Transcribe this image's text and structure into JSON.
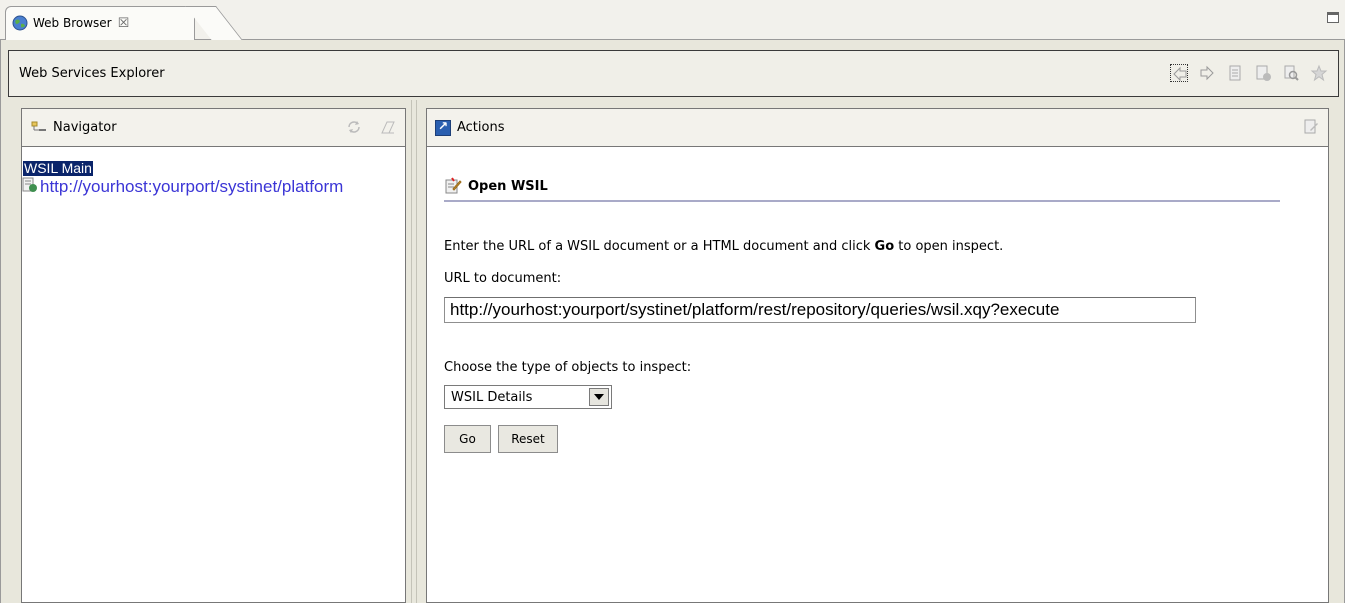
{
  "window": {
    "tab_label": "Web Browser",
    "tab_close": "☒"
  },
  "explorer": {
    "title": "Web Services Explorer",
    "toolbar": [
      "back-icon",
      "forward-icon",
      "history-icon",
      "document-icon",
      "search-icon",
      "favorite-icon"
    ]
  },
  "navigator": {
    "title": "Navigator",
    "tree": {
      "root_label": "WSIL Main",
      "child_label": "http://yourhost:yourport/systinet/platform"
    }
  },
  "actions": {
    "title": "Actions",
    "section_title": "Open WSIL",
    "instruction_before": "Enter the URL of a WSIL document or a HTML document and click ",
    "instruction_bold": "Go",
    "instruction_after": " to open inspect.",
    "url_label": "URL to document:",
    "url_value": "http://yourhost:yourport/systinet/platform/rest/repository/queries/wsil.xqy?execute",
    "type_label": "Choose the type of objects to inspect:",
    "type_selected": "WSIL Details",
    "go_label": "Go",
    "reset_label": "Reset"
  },
  "colors": {
    "selection_bg": "#0a246a",
    "link": "#3b35d6",
    "section_rule": "#a9aac8",
    "frame_bg": "#e8e7dc"
  }
}
